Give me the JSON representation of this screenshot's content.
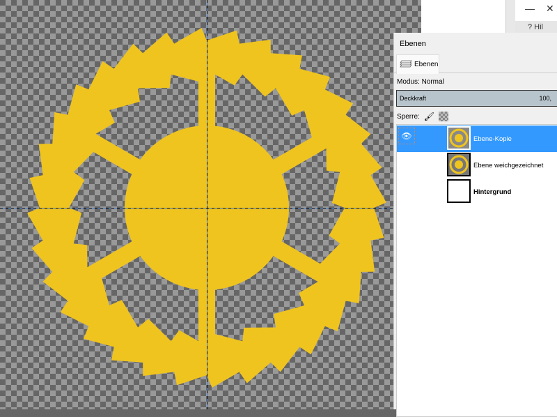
{
  "canvas": {
    "fill_color": "#f0c41e"
  },
  "window": {
    "minimize_icon": "—",
    "close_icon": "✕",
    "help_label": "? Hil"
  },
  "panel": {
    "title": "Ebenen",
    "tab_label": "Ebenen",
    "mode_label": "Modus: Normal",
    "opacity_label": "Deckkraft",
    "opacity_value": "100,",
    "lock_label": "Sperre:",
    "layers": [
      {
        "name": "Ebene-Kopie",
        "selected": true,
        "visible": true
      },
      {
        "name": "Ebene weichgezeichnet",
        "selected": false,
        "visible": false
      },
      {
        "name": "Hintergrund",
        "selected": false,
        "visible": false
      }
    ]
  }
}
